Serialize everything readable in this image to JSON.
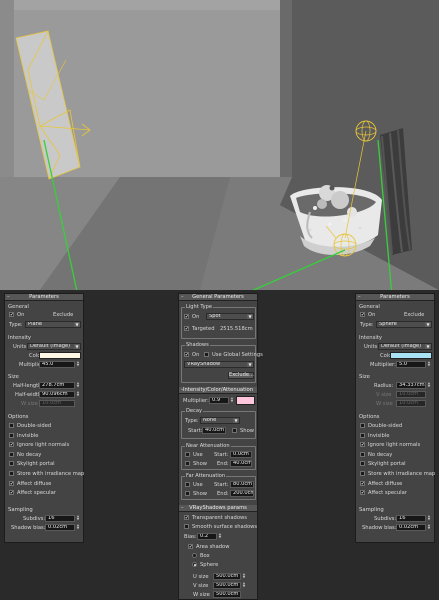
{
  "left": {
    "rollout_title": "Parameters",
    "general": {
      "title": "General",
      "on_label": "On",
      "on_checked": true,
      "exclude_label": "Exclude",
      "type_label": "Type:",
      "type_value": "Plane"
    },
    "intensity": {
      "title": "Intensity",
      "units_label": "Units:",
      "units_value": "Default (image)",
      "color_label": "Color",
      "color_swatch": "#fff8e6",
      "multiplier_label": "Multiplier:",
      "multiplier_value": "45.0"
    },
    "size": {
      "title": "Size",
      "half_length_label": "Half-length:",
      "half_length_value": "278.7cm",
      "half_width_label": "Half-width:",
      "half_width_value": "90.096cm",
      "w_size_label": "W size",
      "w_size_value": "10.0cm"
    },
    "options": {
      "title": "Options",
      "items": [
        {
          "label": "Double-sided",
          "checked": false
        },
        {
          "label": "Invisible",
          "checked": false
        },
        {
          "label": "Ignore light normals",
          "checked": true
        },
        {
          "label": "No decay",
          "checked": false
        },
        {
          "label": "Skylight portal",
          "checked": false
        },
        {
          "label": "Store with irradiance map",
          "checked": false
        },
        {
          "label": "Affect diffuse",
          "checked": true
        },
        {
          "label": "Affect specular",
          "checked": true
        }
      ]
    },
    "sampling": {
      "title": "Sampling",
      "subdivs_label": "Subdivs:",
      "subdivs_value": "16",
      "shadow_bias_label": "Shadow bias:",
      "shadow_bias_value": "0.02cm"
    }
  },
  "middle": {
    "general_params": {
      "rollout_title": "General Parameters",
      "light_type": {
        "title": "Light Type",
        "on_label": "On",
        "on_checked": true,
        "type_value": "Spot",
        "targeted_label": "Targeted",
        "targeted_checked": true,
        "targeted_value": "2515.518cm"
      },
      "shadows": {
        "title": "Shadows",
        "on_label": "On",
        "on_checked": true,
        "global_label": "Use Global Settings",
        "global_checked": false,
        "shadow_type": "VRayShadow",
        "exclude_label": "Exclude..."
      }
    },
    "intensity": {
      "rollout_title": "Intensity/Color/Attenuation",
      "multiplier_label": "Multiplier:",
      "multiplier_value": "0.9",
      "color_swatch": "#ffc6dc",
      "decay": {
        "title": "Decay",
        "type_label": "Type:",
        "type_value": "None",
        "start_label": "Start:",
        "start_value": "40.0cm",
        "show_label": "Show",
        "show_checked": false
      },
      "near": {
        "title": "Near Attenuation",
        "use_label": "Use",
        "use_checked": false,
        "start_label": "Start:",
        "start_value": "0.0cm",
        "show_label": "Show",
        "show_checked": false,
        "end_label": "End:",
        "end_value": "40.0cm"
      },
      "far": {
        "title": "Far Attenuation",
        "use_label": "Use",
        "use_checked": false,
        "start_label": "Start:",
        "start_value": "80.0cm",
        "show_label": "Show",
        "show_checked": false,
        "end_label": "End:",
        "end_value": "200.0cm"
      }
    },
    "vray_shadows": {
      "rollout_title": "VRayShadows params",
      "transparent_label": "Transparent shadows",
      "transparent_checked": true,
      "smooth_label": "Smooth surface shadows",
      "smooth_checked": false,
      "bias_label": "Bias:",
      "bias_value": "0.2",
      "area_label": "Area shadow",
      "area_checked": true,
      "box_label": "Box",
      "box_checked": false,
      "sphere_label": "Sphere",
      "sphere_checked": true,
      "u_label": "U size",
      "u_value": "500.0cm",
      "v_label": "V size",
      "v_value": "500.0cm",
      "w_label": "W size",
      "w_value": "500.0cm"
    }
  },
  "right": {
    "rollout_title": "Parameters",
    "general": {
      "title": "General",
      "on_label": "On",
      "on_checked": true,
      "exclude_label": "Exclude",
      "type_label": "Type:",
      "type_value": "Sphere"
    },
    "intensity": {
      "title": "Intensity",
      "units_label": "Units:",
      "units_value": "Default (image)",
      "color_label": "Color",
      "color_swatch": "#a8e4f6",
      "multiplier_label": "Multiplier:",
      "multiplier_value": "5.0"
    },
    "size": {
      "title": "Size",
      "radius_label": "Radius:",
      "radius_value": "34.337cm",
      "v_size_label": "V size",
      "v_size_value": "10.0cm",
      "w_size_label": "W size",
      "w_size_value": "10.0cm"
    },
    "options": {
      "title": "Options",
      "items": [
        {
          "label": "Double-sided",
          "checked": false
        },
        {
          "label": "Invisible",
          "checked": false
        },
        {
          "label": "Ignore light normals",
          "checked": true
        },
        {
          "label": "No decay",
          "checked": false
        },
        {
          "label": "Skylight portal",
          "checked": false
        },
        {
          "label": "Store with irradiance map",
          "checked": false
        },
        {
          "label": "Affect diffuse",
          "checked": true
        },
        {
          "label": "Affect specular",
          "checked": true
        }
      ]
    },
    "sampling": {
      "title": "Sampling",
      "subdivs_label": "Subdivs:",
      "subdivs_value": "16",
      "shadow_bias_label": "Shadow bias:",
      "shadow_bias_value": "0.02cm"
    }
  },
  "colors": {
    "viewport_bg": "#8f8f8f",
    "light_gizmo": "#e8c63a",
    "callout_line": "#37d03a",
    "panel_bg": "#444444"
  }
}
